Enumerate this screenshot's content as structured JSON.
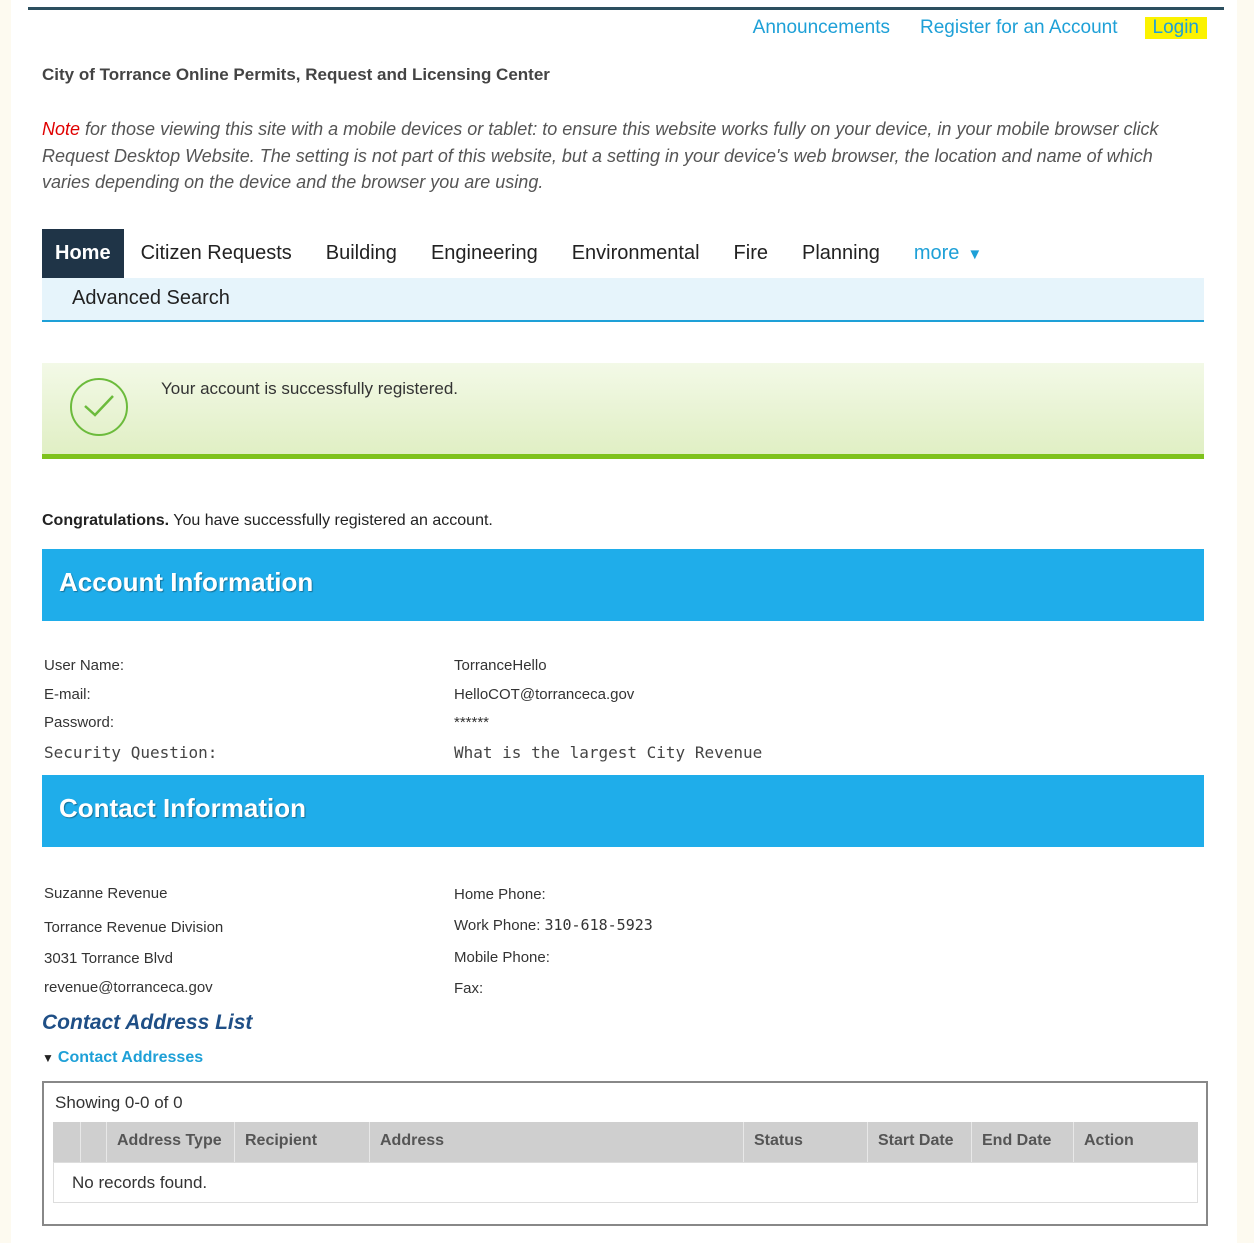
{
  "top_links": {
    "announcements": "Announcements",
    "register": "Register for an Account",
    "login": "Login"
  },
  "site_title": "City of Torrance Online Permits, Request and Licensing Center",
  "note": {
    "label": "Note",
    "text": " for those viewing this site with a mobile devices or tablet: to ensure this website works fully on your device, in your mobile browser click Request Desktop Website. The setting is not part of this website, but a setting in your device's web browser, the location and name of which varies depending on the device and the browser you are using."
  },
  "nav": {
    "tabs": [
      "Home",
      "Citizen Requests",
      "Building",
      "Engineering",
      "Environmental",
      "Fire",
      "Planning"
    ],
    "more": "more",
    "sub_item": "Advanced Search"
  },
  "success_message": "Your account is successfully registered.",
  "congrats": {
    "bold": "Congratulations.",
    "text": " You have successfully registered an account."
  },
  "account_info": {
    "title": "Account Information",
    "rows": [
      {
        "label": "User Name:",
        "value": "TorranceHello"
      },
      {
        "label": "E-mail:",
        "value": "HelloCOT@torranceca.gov"
      },
      {
        "label": "Password:",
        "value": "******"
      },
      {
        "label": "Security Question:",
        "value": "What is the largest City Revenue"
      }
    ]
  },
  "contact_info": {
    "title": "Contact Information",
    "left": [
      "Suzanne Revenue",
      "Torrance Revenue Division",
      "3031 Torrance Blvd",
      "revenue@torranceca.gov"
    ],
    "phones": [
      {
        "label": "Home Phone:",
        "value": ""
      },
      {
        "label": "Work Phone:",
        "value": "310-618-5923"
      },
      {
        "label": "Mobile Phone:",
        "value": ""
      },
      {
        "label": "Fax:",
        "value": ""
      }
    ]
  },
  "address_list": {
    "title": "Contact Address List",
    "toggle": "Contact Addresses",
    "showing": "Showing 0-0 of 0",
    "columns": [
      "Address Type",
      "Recipient",
      "Address",
      "Status",
      "Start Date",
      "End Date",
      "Action"
    ],
    "empty": "No records found."
  },
  "colors": {
    "accent": "#1fadea",
    "nav_active": "#1f3447",
    "success_bar": "#7ec21c",
    "login_highlight": "#fbf200",
    "note_red": "#e00000"
  }
}
